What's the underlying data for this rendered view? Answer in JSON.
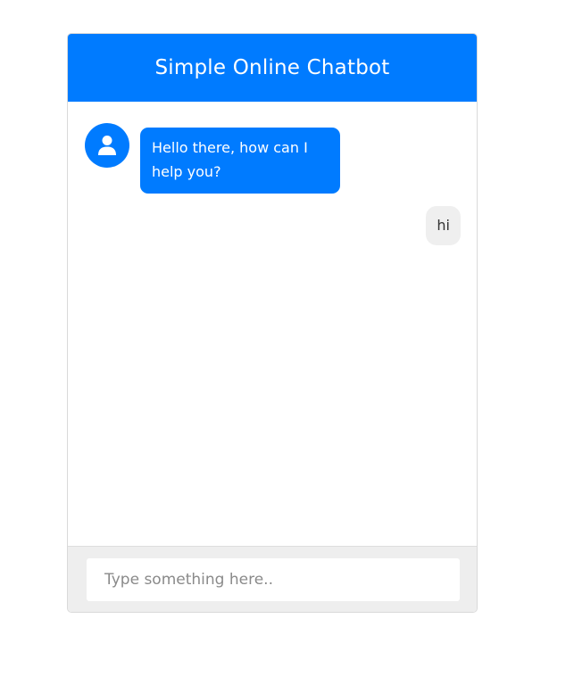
{
  "header": {
    "title": "Simple Online Chatbot"
  },
  "messages": {
    "bot": {
      "text": "Hello there, how can I help you?",
      "avatar_icon": "user-icon"
    },
    "user": {
      "text": "hi"
    }
  },
  "input": {
    "placeholder": "Type something here..",
    "value": ""
  },
  "colors": {
    "accent": "#007bff",
    "user_bubble": "#efefef",
    "footer_bg": "#eeeeee"
  }
}
